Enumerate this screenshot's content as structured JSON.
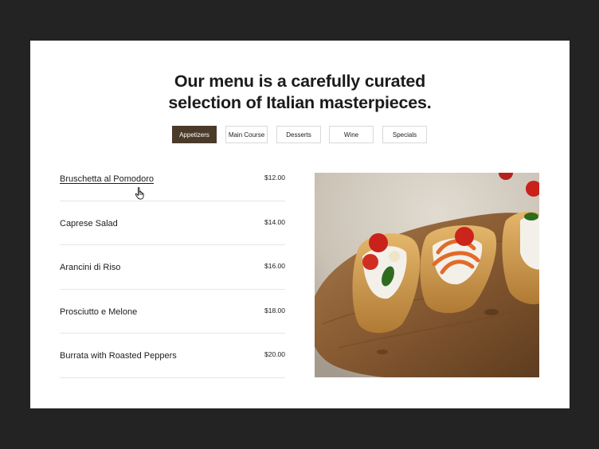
{
  "header": {
    "title_line1": "Our menu is a carefully curated",
    "title_line2": "selection of Italian masterpieces."
  },
  "tabs": [
    {
      "label": "Appetizers",
      "active": true
    },
    {
      "label": "Main Course",
      "active": false
    },
    {
      "label": "Desserts",
      "active": false
    },
    {
      "label": "Wine",
      "active": false
    },
    {
      "label": "Specials",
      "active": false
    }
  ],
  "menu": {
    "items": [
      {
        "name": "Bruschetta al Pomodoro",
        "price": "$12.00"
      },
      {
        "name": "Caprese Salad",
        "price": "$14.00"
      },
      {
        "name": "Arancini di Riso",
        "price": "$16.00"
      },
      {
        "name": "Prosciutto e Melone",
        "price": "$18.00"
      },
      {
        "name": "Burrata with Roasted Peppers",
        "price": "$20.00"
      }
    ]
  },
  "colors": {
    "background": "#232323",
    "card": "#ffffff",
    "accent": "#4b3a2a",
    "text": "#1b1b1b"
  },
  "icons": {
    "cursor": "hand-pointer-icon"
  }
}
